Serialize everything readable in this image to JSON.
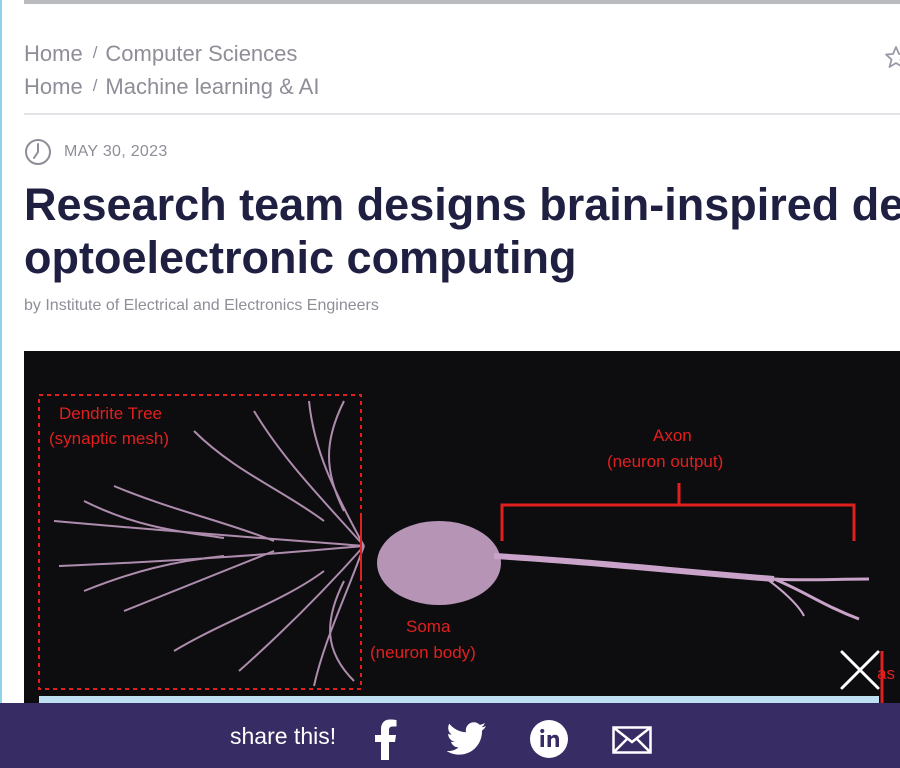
{
  "breadcrumbs": [
    {
      "home": "Home",
      "separator": "/",
      "section": "Computer Sciences"
    },
    {
      "home": "Home",
      "separator": "/",
      "section": "Machine learning & AI"
    }
  ],
  "article": {
    "date": "MAY 30, 2023",
    "title": "Research team designs brain-inspired device for optoelectronic computing",
    "title_line1": "Research team designs brain-inspired de",
    "title_line2": "optoelectronic computing",
    "byline": "by Institute of Electrical and Electronics Engineers"
  },
  "figure": {
    "label_dendrite_1": "Dendrite Tree",
    "label_dendrite_2": "(synaptic mesh)",
    "label_axon_1": "Axon",
    "label_axon_2": "(neuron output)",
    "label_soma_1": "Soma",
    "label_soma_2": "(neuron body)",
    "label_clipped": "as",
    "label_color": "#e0201f",
    "neuron_color": "#c9a3c9"
  },
  "share": {
    "label": "share this!",
    "background": "#372c63",
    "icons": [
      "facebook-icon",
      "twitter-icon",
      "linkedin-icon",
      "email-icon"
    ]
  }
}
